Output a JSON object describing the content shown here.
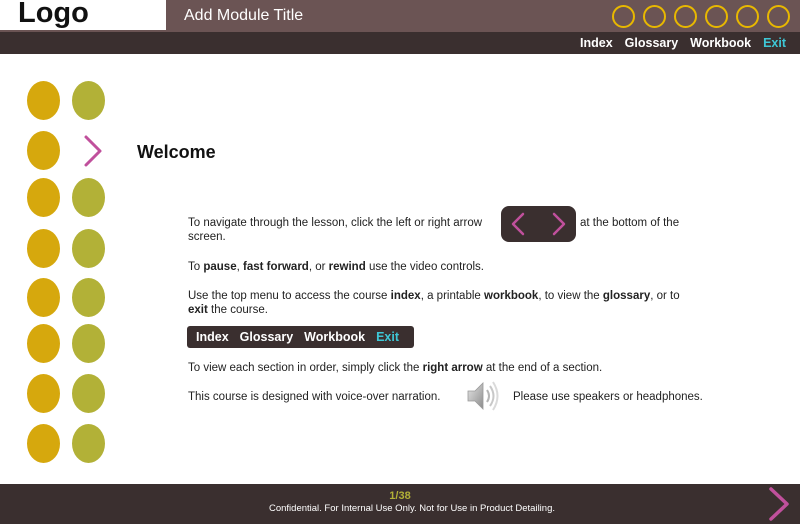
{
  "header": {
    "logo": "Logo",
    "module_title": "Add Module Title",
    "progress_ring_count": 6,
    "ring_color": "#e8b800",
    "bg_color": "#6b5454"
  },
  "top_nav": {
    "items": [
      "Index",
      "Glossary",
      "Workbook",
      "Exit"
    ],
    "exit_color": "#3ec7d6"
  },
  "side_dots": {
    "gold": "#d6a80d",
    "olive": "#b2b137",
    "arrow_color": "#c0509c"
  },
  "main": {
    "title": "Welcome",
    "nav_text_before": "To navigate through the lesson, click the left or right arrow",
    "nav_text_after": "at the bottom of the",
    "nav_text_line2": "screen.",
    "controls_to": "To",
    "controls_pause": "pause",
    "controls_comma1": ",",
    "controls_ff": "fast forward",
    "controls_or": ", or",
    "controls_rewind": "rewind",
    "controls_rest": "use the video controls.",
    "menu_line1_a": "Use the top menu to access the course",
    "menu_index": "index",
    "menu_line1_b": ", a printable",
    "menu_workbook": "workbook",
    "menu_line1_c": ", to view the",
    "menu_glossary": "glossary",
    "menu_line1_d": ", or to",
    "menu_exit": "exit",
    "menu_line2": "the course.",
    "mini_nav": [
      "Index",
      "Glossary",
      "Workbook",
      "Exit"
    ],
    "order_a": "To view each section in order, simply click the",
    "order_bold": "right arrow",
    "order_b": "at the end of a section.",
    "voice_a": "This course is designed with voice-over narration.",
    "voice_b": "Please use speakers or headphones.",
    "speaker_icon": "speaker-icon"
  },
  "footer": {
    "page_number": "1/38",
    "confidential": "Confidential.  For Internal Use Only.  Not for Use in Product Detailing.",
    "page_number_color": "#b2b137",
    "next_arrow_color": "#c0509c"
  }
}
